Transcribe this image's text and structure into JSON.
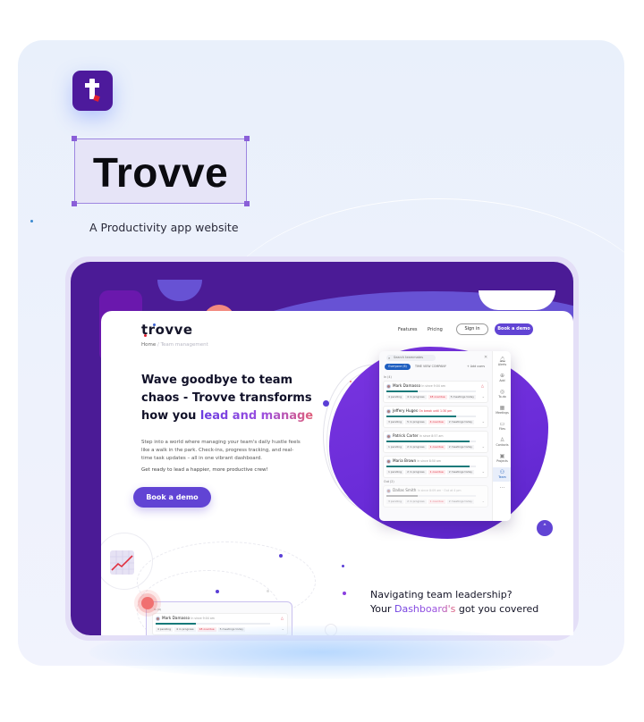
{
  "brand": {
    "name": "Trovve",
    "tagline": "A Productivity app website",
    "icon": "trovve-t-logo-icon",
    "colors": {
      "primary": "#4b1b96",
      "accent": "#6144d4",
      "coral": "#f28a80",
      "teal": "#177a7a"
    }
  },
  "site": {
    "logo": "trovve",
    "breadcrumb": {
      "home": "Home",
      "separator": "/",
      "current": "Team management"
    },
    "nav": {
      "features": "Features",
      "pricing": "Pricing",
      "sign_in": "Sign in",
      "book_demo": "Book a demo"
    },
    "hero": {
      "headline_1": "Wave goodbye to team chaos - Trovve transforms how you ",
      "headline_highlight": "lead and manage",
      "paragraph": "Step into a world where managing your team's daily hustle feels like a walk in the park. Check-ins, progress tracking, and real-time task updates – all in one vibrant dashboard.",
      "paragraph_2": "Get ready to lead a happier, more productive crew!",
      "cta": "Book a demo"
    },
    "dashboard": {
      "search_placeholder": "Search teammates",
      "filter_everyone": "Everyone (6)",
      "filter_company": "TIME VIEW COMPANY",
      "add_users": "+ Add users",
      "section_in": "In (4)",
      "section_out": "Out (2)",
      "members": [
        {
          "name": "Mark Damasso",
          "status": "In since 9:04 am",
          "status_red": false,
          "progress": 0.35,
          "tags": [
            "4 pending",
            "4 in progress",
            "18 overdue",
            "5 meetings today"
          ],
          "warn": true
        },
        {
          "name": "Jeffery Huges",
          "status": "On break until 1:30 pm",
          "status_red": true,
          "progress": 0.78,
          "tags": [
            "3 pending",
            "5 in progress",
            "4 overdue",
            "2 meetings today"
          ],
          "warn": false
        },
        {
          "name": "Patrick Carter",
          "status": "In since 8:57 am",
          "status_red": false,
          "progress": 0.93,
          "tags": [
            "1 pending",
            "2 in progress",
            "1 overdue",
            "2 meetings today"
          ],
          "warn": false
        },
        {
          "name": "Maria Brown",
          "status": "In since 8:50 am",
          "status_red": false,
          "progress": 0.93,
          "tags": [
            "1 pending",
            "2 in progress",
            "1 overdue",
            "2 meetings today"
          ],
          "warn": false
        },
        {
          "name": "Dallas Smith",
          "status": "In since 8:09 am · Out at 4 pm",
          "status_red": false,
          "progress": 0.35,
          "tags": [
            "3 pending",
            "2 in progress",
            "1 overdue",
            "2 meetings today"
          ],
          "warn": false
        }
      ],
      "sidebar": [
        {
          "label": "Alerts",
          "icon": "bell-icon",
          "glyph": "🔔︎"
        },
        {
          "label": "Add",
          "icon": "plus-circle-icon",
          "glyph": "⊕"
        },
        {
          "label": "To-do",
          "icon": "check-circle-icon",
          "glyph": "◎"
        },
        {
          "label": "Meetings",
          "icon": "calendar-icon",
          "glyph": "▦"
        },
        {
          "label": "Files",
          "icon": "folder-icon",
          "glyph": "▭"
        },
        {
          "label": "Contacts",
          "icon": "person-icon",
          "glyph": "♙"
        },
        {
          "label": "Projects",
          "icon": "briefcase-icon",
          "glyph": "▣"
        },
        {
          "label": "Team",
          "icon": "team-icon",
          "glyph": "⚇",
          "active": true
        },
        {
          "label": "",
          "icon": "more-icon",
          "glyph": "···"
        }
      ]
    },
    "mini_dashboard": {
      "section_in": "In (4)",
      "member": {
        "name": "Mark Damasso",
        "status": "In since 9:04 am",
        "progress": 0.35,
        "tags": [
          "4 pending",
          "4 in progress",
          "18 overdue",
          "5 meetings today"
        ]
      }
    },
    "section_2": {
      "line_1": "Navigating team leadership?",
      "line_2_pre": "Your ",
      "line_2_highlight": "Dashboard's",
      "line_2_post": " got you covered"
    }
  }
}
